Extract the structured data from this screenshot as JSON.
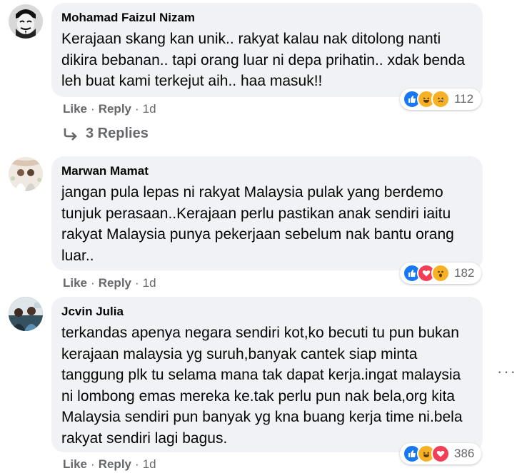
{
  "comments": [
    {
      "author": "Mohamad Faizul Nizam",
      "text": "Kerajaan skang kan unik.. rakyat kalau nak ditolong nanti dikira bebanan.. tapi orang luar ni depa prihatin.. xdak benda leh buat kami terkejut aih.. haa masuk!!",
      "like": "Like",
      "reply": "Reply",
      "time": "1d",
      "reaction_count": "112",
      "reactions": [
        "like-icon",
        "haha-icon",
        "sad-icon"
      ]
    },
    {
      "author": "Marwan Mamat",
      "text": "jangan pula lepas ni rakyat Malaysia pulak yang berdemo tunjuk perasaan..Kerajaan perlu pastikan anak sendiri iaitu rakyat Malaysia punya pekerjaan sebelum nak bantu orang luar..",
      "like": "Like",
      "reply": "Reply",
      "time": "1d",
      "reaction_count": "182",
      "reactions": [
        "like-icon",
        "love-icon",
        "wow-icon"
      ]
    },
    {
      "author": "Jcvin Julia",
      "text": "terkandas apenya negara sendiri kot,ko becuti tu pun bukan kerajaan malaysia yg suruh,banyak cantek siap minta tanggung plk tu selama mana tak dapat kerja.ingat malaysia ni lombong emas mereka ke.tak perlu pun nak bela,org kita Malaysia sendiri pun banyak yg kna buang kerja time ni.bela rakyat sendiri lagi bagus.",
      "like": "Like",
      "reply": "Reply",
      "time": "1d",
      "reaction_count": "386",
      "reactions": [
        "like-icon",
        "haha-icon",
        "love-icon"
      ]
    }
  ],
  "replies_label": "3 Replies",
  "colors": {
    "bubble": "#f0f2f5",
    "meta": "#65676b",
    "like": "#1877f2",
    "love": "#f33e58",
    "reaction_yellow": "#f7b125"
  }
}
